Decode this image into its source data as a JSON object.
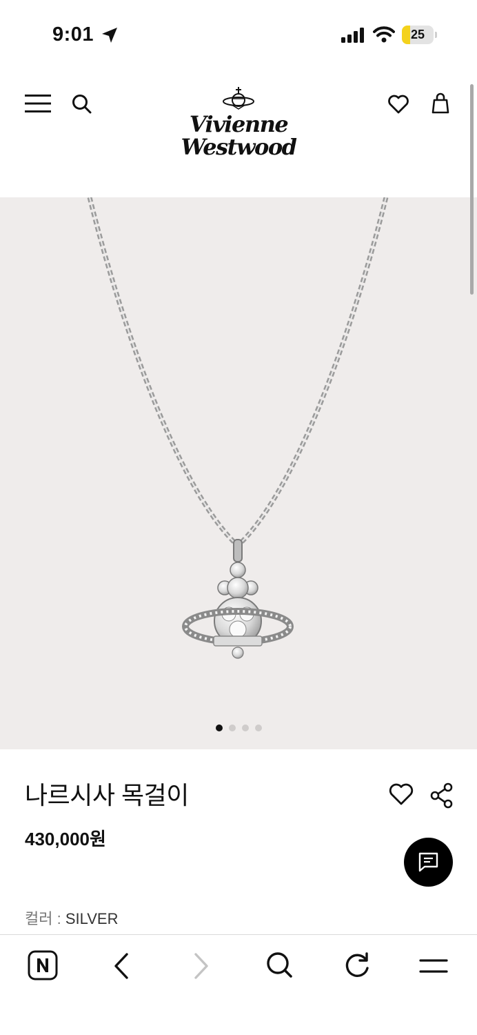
{
  "status_bar": {
    "time": "9:01",
    "battery": "25",
    "battery_level_percent": 25,
    "icons": [
      "location-arrow-icon",
      "cellular-signal-icon",
      "wifi-icon",
      "battery-icon"
    ]
  },
  "header": {
    "menu_icon": "hamburger-menu-icon",
    "search_icon": "search-icon",
    "logo_line1": "Vivienne",
    "logo_line2": "Westwood",
    "wishlist_icon": "heart-icon",
    "bag_icon": "shopping-bag-icon"
  },
  "gallery": {
    "background": "#efeceb",
    "image_count": 4,
    "active_index": 0
  },
  "product": {
    "name": "나르시사 목걸이",
    "price": "430,000원",
    "color_label": "컬러 : ",
    "color_value": "SILVER",
    "wish_icon": "heart-outline-icon",
    "share_icon": "share-icon",
    "chat_icon": "chat-bubble-icon"
  },
  "toolbar": {
    "items": [
      "naver-home-icon",
      "back-arrow-icon",
      "forward-arrow-icon",
      "search-icon",
      "refresh-icon",
      "menu-icon"
    ]
  },
  "colors": {
    "text": "#111111",
    "gallery_bg": "#efeceb",
    "battery_fill": "#f4d21c",
    "disabled": "#c4c4c4"
  }
}
